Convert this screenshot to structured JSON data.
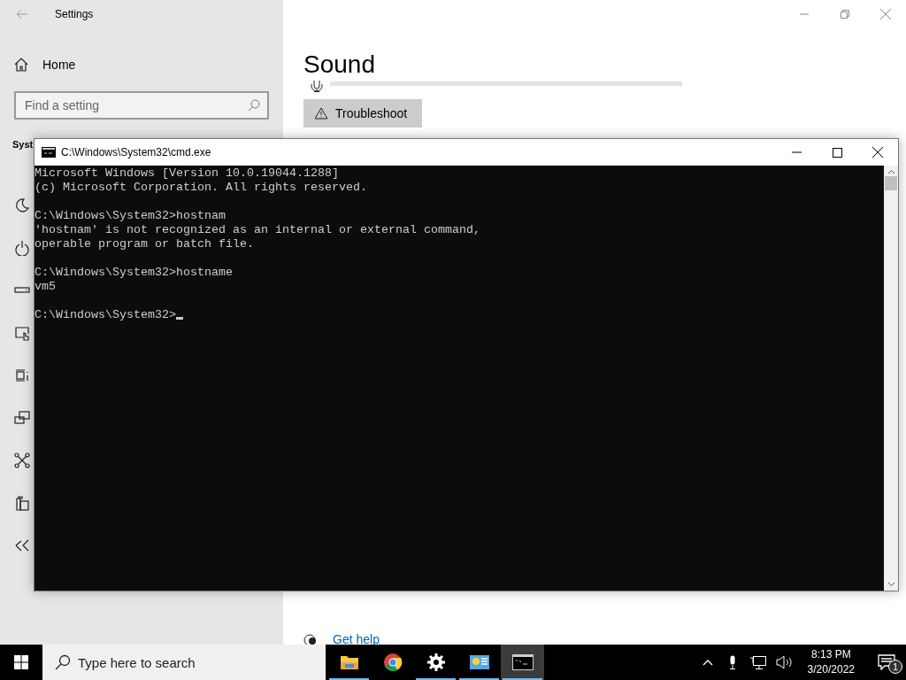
{
  "settings": {
    "title": "Settings",
    "home": "Home",
    "search": {
      "placeholder": "Find a setting"
    },
    "section": "Syst",
    "page_title": "Sound",
    "input_meter": {
      "level": 0
    },
    "troubleshoot": "Troubleshoot",
    "get_help": "Get help"
  },
  "cmd": {
    "title": "C:\\Windows\\System32\\cmd.exe",
    "blocks": [
      [
        "Microsoft Windows [Version 10.0.19044.1288]",
        "(c) Microsoft Corporation. All rights reserved."
      ],
      [
        "C:\\Windows\\System32>hostnam",
        "'hostnam' is not recognized as an internal or external command,",
        "operable program or batch file."
      ],
      [
        "C:\\Windows\\System32>hostname",
        "vm5"
      ],
      [
        "C:\\Windows\\System32>"
      ]
    ],
    "cursor": true
  },
  "taskbar": {
    "search": {
      "placeholder": "Type here to search"
    },
    "apps": [
      {
        "kind": "folder",
        "running": true,
        "selected": false
      },
      {
        "kind": "browser",
        "running": false,
        "selected": false
      },
      {
        "kind": "gear",
        "running": true,
        "selected": false
      },
      {
        "kind": "panel",
        "running": true,
        "selected": false
      },
      {
        "kind": "console",
        "running": true,
        "selected": true
      }
    ],
    "time": "8:13 PM",
    "date": "3/20/2022",
    "notifications": "1"
  }
}
